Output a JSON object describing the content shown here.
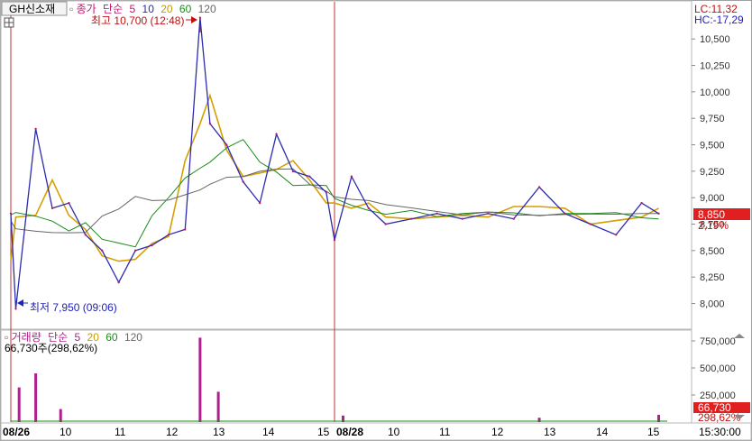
{
  "window": {
    "ticker_title": "GH신소재",
    "range_labels": {
      "lc": "LC:11,32",
      "hc": "HC:-17,29"
    }
  },
  "price_panel": {
    "legend": [
      "종가",
      "단순",
      "5",
      "10",
      "20",
      "60",
      "120"
    ],
    "high_marker": "최고 10,700 (12:48)",
    "low_marker": "최저 7,950 (09:06)",
    "current_price": "8,850",
    "current_change": "2,19%"
  },
  "volume_panel": {
    "legend": [
      "거래량",
      "단순",
      "5",
      "20",
      "60",
      "120"
    ],
    "volume_text": "66,730주(298,62%)",
    "current_volume": "66,730",
    "current_ratio": "298,62%"
  },
  "x_axis": {
    "labels": [
      "08/26",
      "10",
      "11",
      "12",
      "13",
      "14",
      "15",
      "08/28",
      "10",
      "11",
      "12",
      "13",
      "14",
      "15",
      "15:30:00"
    ]
  },
  "colors": {
    "price_line": "#2b2bb0",
    "price_alt": "#c0186c",
    "ma5": "#d4a000",
    "ma10": "#3a3a9a",
    "ma20": "#c89b00",
    "ma60": "#1a8a1a",
    "ma120": "#666666",
    "volume_bar": "#b0208c",
    "session_line": "#c03030",
    "current_box": "#e02020"
  },
  "chart_data": [
    {
      "type": "line",
      "title": "GH신소재",
      "series": [
        {
          "name": "종가",
          "x": [
            "08/26 09:00",
            "08/26 09:06",
            "08/26 09:30",
            "08/26 09:50",
            "08/26 10:10",
            "08/26 10:30",
            "08/26 10:50",
            "08/26 11:10",
            "08/26 11:30",
            "08/26 11:50",
            "08/26 12:10",
            "08/26 12:30",
            "08/26 12:48",
            "08/26 13:00",
            "08/26 13:20",
            "08/26 13:40",
            "08/26 14:00",
            "08/26 14:20",
            "08/26 14:40",
            "08/26 15:00",
            "08/26 15:20",
            "08/28 09:00",
            "08/28 09:20",
            "08/28 09:40",
            "08/28 10:00",
            "08/28 10:30",
            "08/28 11:00",
            "08/28 11:30",
            "08/28 12:00",
            "08/28 12:30",
            "08/28 13:00",
            "08/28 13:30",
            "08/28 14:00",
            "08/28 14:30",
            "08/28 15:00",
            "08/28 15:20"
          ],
          "y": [
            8850,
            7950,
            9650,
            8900,
            8950,
            8650,
            8500,
            8200,
            8500,
            8550,
            8650,
            8700,
            10700,
            9700,
            9500,
            9150,
            8950,
            9600,
            9250,
            9200,
            9050,
            8600,
            9200,
            8900,
            8750,
            8800,
            8850,
            8800,
            8850,
            8800,
            9100,
            8850,
            8750,
            8650,
            8950,
            8850
          ]
        }
      ],
      "ylim": [
        7800,
        10800
      ],
      "y_ticks": [
        8000,
        8250,
        8500,
        8750,
        9000,
        9250,
        9500,
        9750,
        10000,
        10250,
        10500
      ],
      "y_tick_labels": [
        "8,000",
        "8,250",
        "8,500",
        "8,750",
        "9,000",
        "9,250",
        "9,500",
        "9,750",
        "10,000",
        "10,250",
        "10,500"
      ],
      "grid": false
    },
    {
      "type": "bar",
      "title": "거래량",
      "series": [
        {
          "name": "거래량",
          "x": [
            "08/26 09:10",
            "08/26 09:30",
            "08/26 10:00",
            "08/26 12:48",
            "08/26 13:10",
            "08/28 09:10",
            "08/28 13:00",
            "08/28 15:20"
          ],
          "y": [
            320000,
            450000,
            120000,
            780000,
            280000,
            60000,
            40000,
            66730
          ]
        }
      ],
      "ylim": [
        0,
        800000
      ],
      "y_ticks": [
        250000,
        500000,
        750000
      ],
      "y_tick_labels": [
        "250,000",
        "500,000",
        "750,000"
      ]
    }
  ]
}
